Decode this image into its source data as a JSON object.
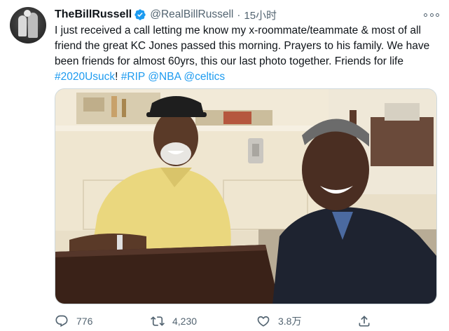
{
  "tweet": {
    "display_name": "TheBillRussell",
    "handle": "@RealBillRussell",
    "separator": "·",
    "time": "15小时",
    "text_main": "I just received a call letting me know my x-roommate/teammate & most of all friend the great KC Jones passed this morning. Prayers to his family. We have been friends for almost 60yrs, this our last photo together. Friends for life ",
    "hashtag_2020": "#2020Usuck",
    "text_bang": "! ",
    "hashtag_rip": "#RIP",
    "mention_nba": "@NBA",
    "mention_celtics": "@celtics",
    "verified_icon": "verified-badge-icon",
    "link_color": "#1d9bf0"
  },
  "actions": {
    "reply_count": "776",
    "retweet_count": "4,230",
    "like_count": "3.8万",
    "reply_icon": "reply-icon",
    "retweet_icon": "retweet-icon",
    "like_icon": "heart-icon",
    "share_icon": "share-icon"
  }
}
